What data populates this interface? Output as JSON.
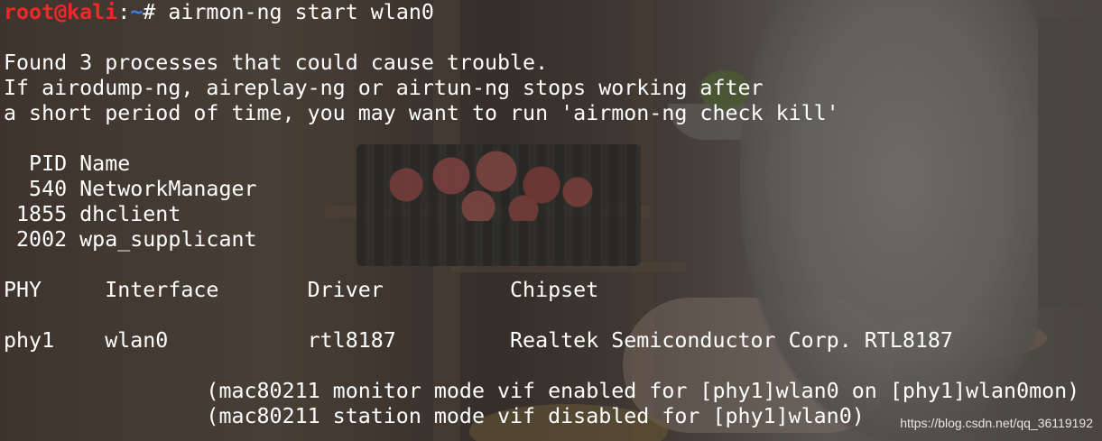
{
  "prompt": {
    "user_host": "root@kali",
    "colon": ":",
    "path": "~",
    "symbol": "#",
    "command": " airmon-ng start wlan0"
  },
  "output_lines": [
    "",
    "Found 3 processes that could cause trouble.",
    "If airodump-ng, aireplay-ng or airtun-ng stops working after",
    "a short period of time, you may want to run 'airmon-ng check kill'",
    "",
    "  PID Name",
    "  540 NetworkManager",
    " 1855 dhclient",
    " 2002 wpa_supplicant",
    "",
    "PHY     Interface       Driver          Chipset",
    "",
    "phy1    wlan0           rtl8187         Realtek Semiconductor Corp. RTL8187",
    "",
    "                (mac80211 monitor mode vif enabled for [phy1]wlan0 on [phy1]wlan0mon)",
    "                (mac80211 station mode vif disabled for [phy1]wlan0)"
  ],
  "watermark": "https://blog.csdn.net/qq_36119192",
  "colors": {
    "prompt_user": "#ef2929",
    "prompt_path": "#3d7ff0",
    "text": "#ffffff"
  }
}
